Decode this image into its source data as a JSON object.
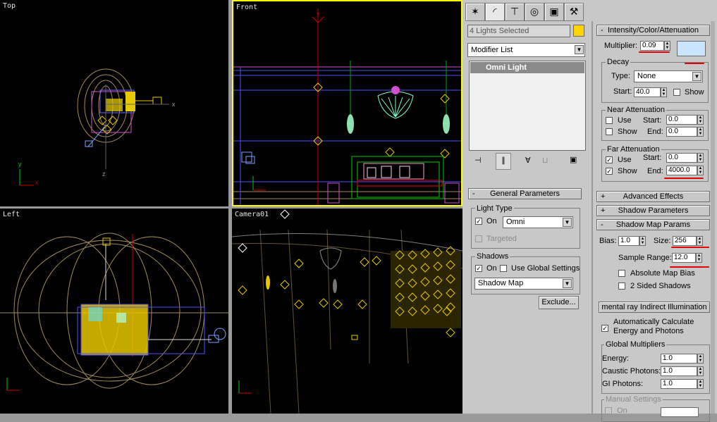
{
  "viewports": {
    "top": {
      "label": "Top"
    },
    "front": {
      "label": "Front"
    },
    "left": {
      "label": "Left"
    },
    "camera": {
      "label": "Camera01"
    }
  },
  "toolbar": {
    "icons": [
      "create-icon",
      "modify-icon",
      "hierarchy-icon",
      "motion-icon",
      "display-icon",
      "utilities-icon"
    ]
  },
  "selection": {
    "name": "4 Lights Selected",
    "color": "#ffd400"
  },
  "modifier": {
    "list_label": "Modifier List",
    "stack_item": "Omni Light"
  },
  "general": {
    "title": "General Parameters",
    "light_type_label": "Light Type",
    "on_label": "On",
    "type_value": "Omni",
    "targeted_label": "Targeted",
    "shadows_label": "Shadows",
    "shadows_on_label": "On",
    "global_label": "Use Global Settings",
    "shadow_type": "Shadow Map",
    "exclude_label": "Exclude..."
  },
  "intensity": {
    "title": "Intensity/Color/Attenuation",
    "multiplier_label": "Multiplier:",
    "multiplier": "0.09",
    "color": "#c8e4ff",
    "decay_label": "Decay",
    "type_label": "Type:",
    "type_value": "None",
    "start_label": "Start:",
    "start_value": "40.0",
    "show_label": "Show"
  },
  "near": {
    "title": "Near Attenuation",
    "use_label": "Use",
    "show_label": "Show",
    "start_label": "Start:",
    "start_value": "0.0",
    "end_label": "End:",
    "end_value": "0.0"
  },
  "far": {
    "title": "Far Attenuation",
    "use_label": "Use",
    "show_label": "Show",
    "start_label": "Start:",
    "start_value": "0.0",
    "end_label": "End:",
    "end_value": "4000.0"
  },
  "rollouts": {
    "advanced": "Advanced Effects",
    "shadow_params": "Shadow Parameters",
    "shadow_map": "Shadow Map Params"
  },
  "shadowmap": {
    "bias_label": "Bias:",
    "bias": "1.0",
    "size_label": "Size:",
    "size": "256",
    "sample_label": "Sample Range:",
    "sample": "12.0",
    "abs_label": "Absolute Map Bias",
    "two_label": "2 Sided Shadows"
  },
  "mentalray": {
    "title": "mental ray Indirect Illumination",
    "auto_label": "Automatically Calculate",
    "auto_label2": "Energy and Photons",
    "global_label": "Global Multipliers",
    "energy_label": "Energy:",
    "energy": "1.0",
    "caustic_label": "Caustic Photons:",
    "caustic": "1.0",
    "gi_label": "GI Photons:",
    "gi": "1.0",
    "manual_label": "Manual Settings",
    "on_label": "On"
  }
}
